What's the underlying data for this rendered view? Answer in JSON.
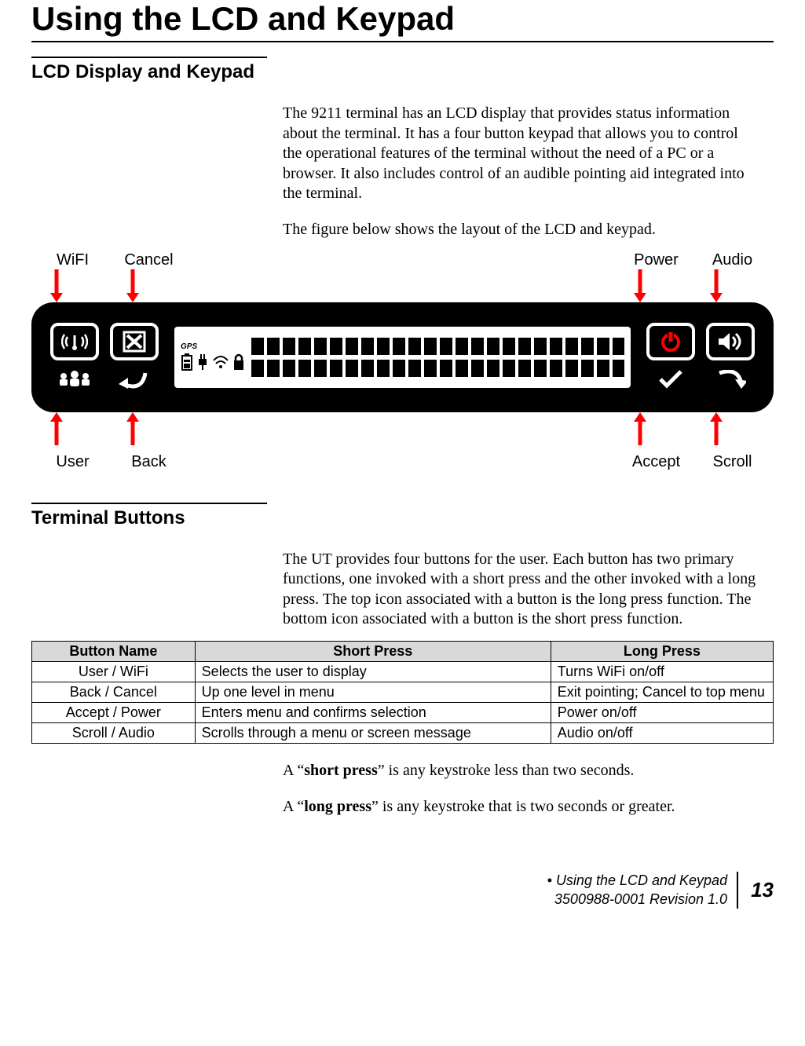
{
  "chapter_title": "Using the LCD and Keypad",
  "section1": {
    "title": "LCD Display and Keypad",
    "p1": "The 9211 terminal has an LCD display that provides status information about the terminal. It has a four button keypad that allows you to control the operational features of the terminal without the need of a PC or a browser. It also includes control of an audible pointing aid integrated into the terminal.",
    "p2": "The figure below shows the layout of the LCD and keypad."
  },
  "figure": {
    "top_labels": {
      "wifi": "WiFI",
      "cancel": "Cancel",
      "power": "Power",
      "audio": "Audio"
    },
    "bottom_labels": {
      "user": "User",
      "back": "Back",
      "accept": "Accept",
      "scroll": "Scroll"
    },
    "lcd_gps": "GPS"
  },
  "section2": {
    "title": "Terminal Buttons",
    "p1": "The UT provides four buttons for the user. Each button has two primary functions, one invoked with a short press and the other invoked with a long press. The top icon associated with a button is the long press function. The bottom icon associated with a button is the short press function."
  },
  "table": {
    "headers": {
      "name": "Button Name",
      "short": "Short Press",
      "long": "Long Press"
    },
    "rows": [
      {
        "name": "User / WiFi",
        "short": "Selects the user to display",
        "long": "Turns WiFi on/off"
      },
      {
        "name": "Back / Cancel",
        "short": "Up one level in menu",
        "long": "Exit pointing; Cancel to top menu"
      },
      {
        "name": "Accept / Power",
        "short": "Enters menu and confirms selection",
        "long": "Power on/off"
      },
      {
        "name": "Scroll / Audio",
        "short": "Scrolls through a menu or screen message",
        "long": "Audio on/off"
      }
    ]
  },
  "press_defs": {
    "short_pre": "A “",
    "short_bold": "short press",
    "short_post": "” is any keystroke less than two seconds.",
    "long_pre": "A “",
    "long_bold": "long press",
    "long_post": "” is any keystroke that is two seconds or greater."
  },
  "footer": {
    "bullet": "• ",
    "line1": "Using the LCD and Keypad",
    "line2": "3500988-0001  Revision 1.0",
    "page": "13"
  }
}
